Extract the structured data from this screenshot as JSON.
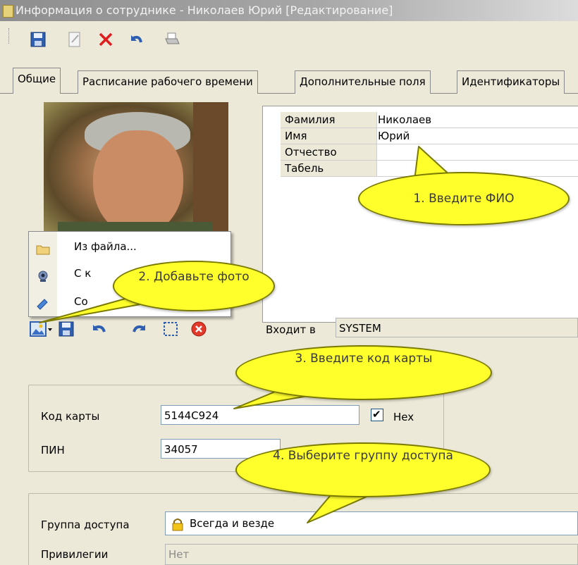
{
  "window": {
    "title": "Информация о сотруднике - Николаев Юрий  [Редактирование]"
  },
  "toolbar": {
    "buttons": [
      "save-icon",
      "edit-icon",
      "delete-icon",
      "undo-icon",
      "print-icon"
    ]
  },
  "tabs": [
    {
      "label": "Общие",
      "active": true
    },
    {
      "label": "Расписание рабочего времени"
    },
    {
      "label": "Дополнительные поля"
    },
    {
      "label": "Идентификаторы"
    }
  ],
  "person_grid": {
    "rows": [
      {
        "label": "Фамилия",
        "value": "Николаев"
      },
      {
        "label": "Имя",
        "value": "Юрий"
      },
      {
        "label": "Отчество",
        "value": ""
      },
      {
        "label": "Табель",
        "value": ""
      }
    ]
  },
  "photo_menu": {
    "items": [
      {
        "label": "Из файла...",
        "icon": "folder-icon"
      },
      {
        "label": "С к",
        "icon": "webcam-icon"
      },
      {
        "label": "Со",
        "icon": "save-as-icon"
      }
    ]
  },
  "photo_toolbar": {
    "buttons": [
      "image-dropdown-icon",
      "save-icon",
      "undo-icon",
      "redo-icon",
      "select-icon",
      "clear-icon"
    ]
  },
  "member_of": {
    "label": "Входит в",
    "value": "SYSTEM"
  },
  "card": {
    "code_label": "Код карты",
    "code_value": "5144C924",
    "hex_label": "Hex",
    "hex_checked": true,
    "pin_label": "ПИН",
    "pin_value": "34057"
  },
  "access": {
    "group_label": "Группа доступа",
    "group_value": "Всегда и везде",
    "privileges_label": "Привилегии",
    "privileges_value": "Нет"
  },
  "callouts": [
    {
      "text": "1. Введите ФИО"
    },
    {
      "text": "2. Добавьте фото"
    },
    {
      "text": "3. Введите код карты"
    },
    {
      "text": "4. Выберите группу доступа"
    }
  ],
  "colors": {
    "callout": "#ffff2c",
    "title_bar": "#a7a7a7",
    "window_bg": "#ece9d8"
  }
}
